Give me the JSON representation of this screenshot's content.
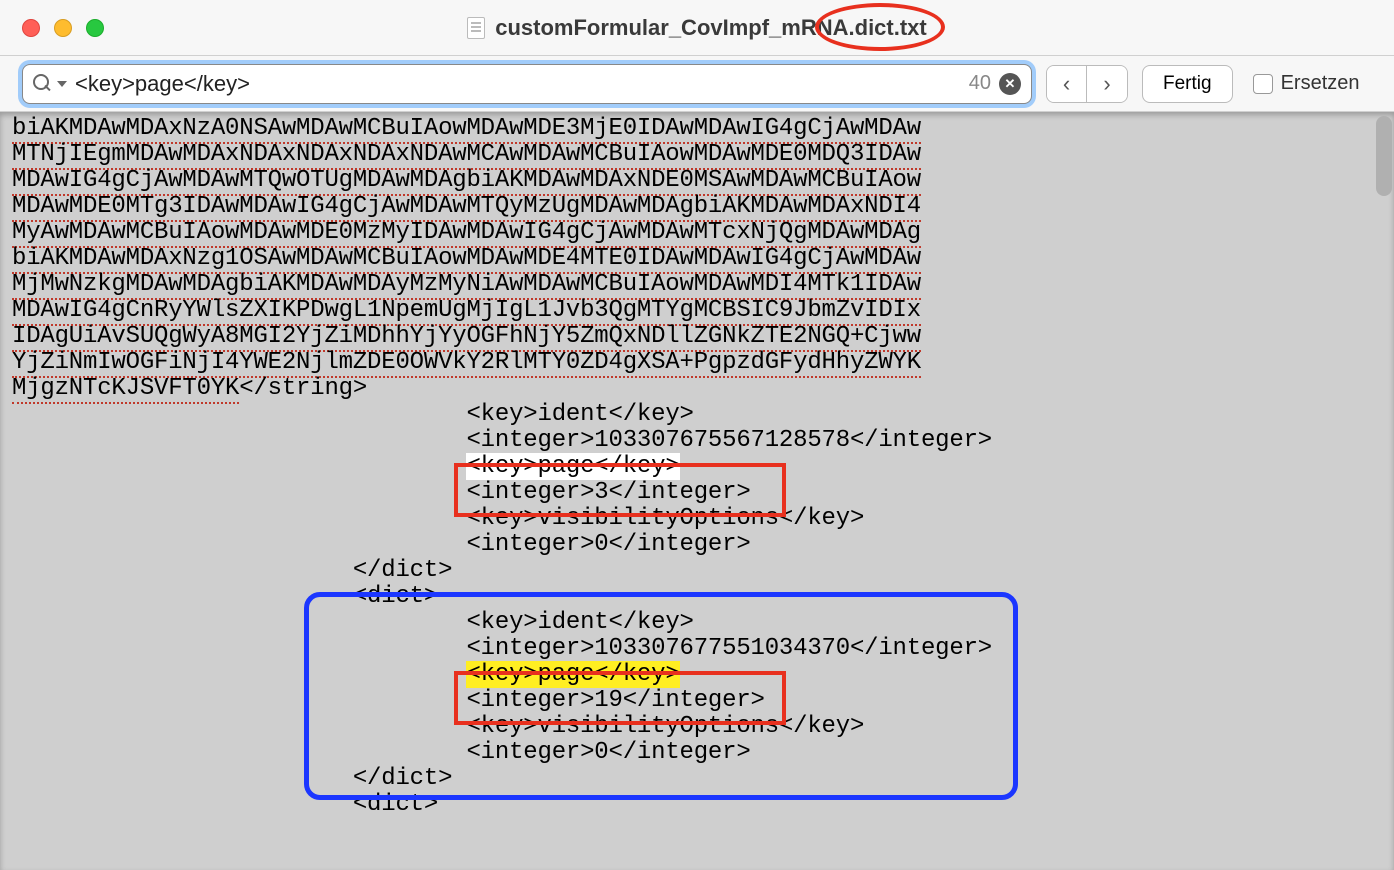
{
  "window": {
    "title": "customFormular_CovImpf_mRNA.dict.txt"
  },
  "findbar": {
    "query": "<key>page</key>",
    "result_count": "40",
    "done_label": "Fertig",
    "replace_label": "Ersetzen"
  },
  "content": {
    "b64_lines": [
      "biAKMDAwMDAxNzA0NSAwMDAwMCBuIAowMDAwMDE3MjE0IDAwMDAwIG4gCjAwMDAw",
      "MTNjIEgmMDAwMDAxNDAxNDAxNDAxNDAwMCAwMDAwMCBuIAowMDAwMDE0MDQ3IDAw",
      "MDAwIG4gCjAwMDAwMTQwOTUgMDAwMDAgbiAKMDAwMDAxNDE0MSAwMDAwMCBuIAow",
      "MDAwMDE0MTg3IDAwMDAwIG4gCjAwMDAwMTQyMzUgMDAwMDAgbiAKMDAwMDAxNDI4",
      "MyAwMDAwMCBuIAowMDAwMDE0MzMyIDAwMDAwIG4gCjAwMDAwMTcxNjQgMDAwMDAg",
      "biAKMDAwMDAxNzg1OSAwMDAwMCBuIAowMDAwMDE4MTE0IDAwMDAwIG4gCjAwMDAw",
      "MjMwNzkgMDAwMDAgbiAKMDAwMDAyMzMyNiAwMDAwMCBuIAowMDAwMDI4MTk1IDAw",
      "MDAwIG4gCnRyYWlsZXIKPDwgL1NpemUgMjIgL1Jvb3QgMTYgMCBSIC9JbmZvIDIx",
      "IDAgUiAvSUQgWyA8MGI2YjZiMDhhYjYyOGFhNjY5ZmQxNDllZGNkZTE2NGQ+Cjww",
      "YjZiNmIwOGFiNjI4YWE2NjlmZDE0OWVkY2RlMTY0ZD4gXSA+PgpzdGFydHhyZWYK",
      "MjgzNTcKJSVFT0YK"
    ],
    "close_string": "</string>",
    "block1": {
      "ident_key": "<key>ident</key>",
      "ident_val": "<integer>103307675567128578</integer>",
      "page_key": "<key>page</key>",
      "page_val": "<integer>3</integer>",
      "vis_key": "<key>visibilityOptions</key>",
      "vis_val": "<integer>0</integer>",
      "close": "</dict>"
    },
    "block2": {
      "open": "<dict>",
      "ident_key": "<key>ident</key>",
      "ident_val": "<integer>103307677551034370</integer>",
      "page_key": "<key>page</key>",
      "page_val": "<integer>19</integer>",
      "vis_key": "<key>visibilityOptions</key>",
      "vis_val": "<integer>0</integer>",
      "close": "</dict>"
    },
    "block3": {
      "open": "<dict>"
    }
  }
}
